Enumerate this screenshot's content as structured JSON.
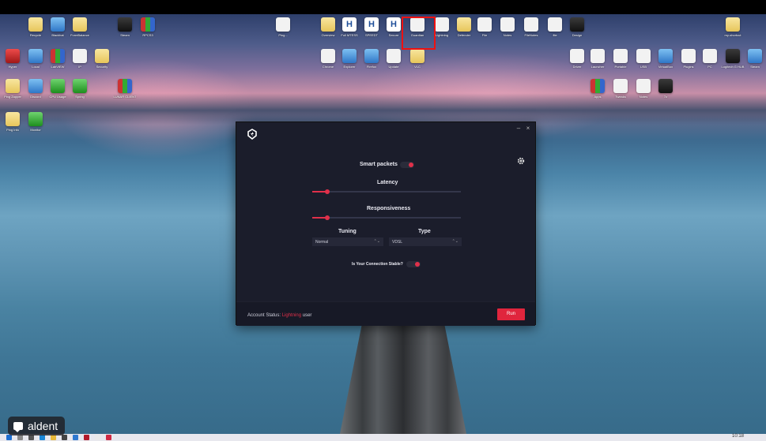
{
  "desktop": {
    "icons": [
      {
        "label": "Recycle",
        "style": "yellow"
      },
      {
        "label": "Blackhat",
        "style": "blue"
      },
      {
        "label": "FormBalance",
        "style": "yellow"
      },
      {
        "label": "Steam",
        "style": "dark"
      },
      {
        "label": "RPCS3",
        "style": "multi"
      },
      {
        "label": "Ping...",
        "style": "white"
      },
      {
        "label": "Overview",
        "style": "yellow"
      },
      {
        "label": "Full MTESS",
        "style": "h"
      },
      {
        "label": "SPEEDT",
        "style": "h"
      },
      {
        "label": "Secure",
        "style": "h"
      },
      {
        "label": "Guardian",
        "style": "white"
      },
      {
        "label": "Lightning",
        "style": "white"
      },
      {
        "label": "Defender",
        "style": "yellow"
      },
      {
        "label": "File",
        "style": "white"
      },
      {
        "label": "Notes",
        "style": "white"
      },
      {
        "label": "FileNotes",
        "style": "white"
      },
      {
        "label": "file",
        "style": "white"
      },
      {
        "label": "Design",
        "style": "dark"
      },
      {
        "label": "my-shortcut",
        "style": "yellow"
      },
      {
        "label": "Hyper",
        "style": "red"
      },
      {
        "label": "Local",
        "style": "blue"
      },
      {
        "label": "LabVIEW",
        "style": "multi"
      },
      {
        "label": "IP",
        "style": "white"
      },
      {
        "label": "Security",
        "style": "yellow"
      },
      {
        "label": "Chrome",
        "style": "white"
      },
      {
        "label": "Explorer",
        "style": "blue"
      },
      {
        "label": "Firefox",
        "style": "blue"
      },
      {
        "label": "Update",
        "style": "white"
      },
      {
        "label": "VLC",
        "style": "yellow"
      },
      {
        "label": "Driver",
        "style": "white"
      },
      {
        "label": "Launcher",
        "style": "white"
      },
      {
        "label": "Portable",
        "style": "white"
      },
      {
        "label": "USB",
        "style": "white"
      },
      {
        "label": "VirtualBox",
        "style": "blue"
      },
      {
        "label": "Plugins",
        "style": "white"
      },
      {
        "label": "PC",
        "style": "white"
      },
      {
        "label": "Logitech G HUB",
        "style": "dark"
      },
      {
        "label": "Steam",
        "style": "blue"
      },
      {
        "label": "Ping Zapper",
        "style": "yellow"
      },
      {
        "label": "Discord",
        "style": "blue"
      },
      {
        "label": "CPU Usage",
        "style": "green"
      },
      {
        "label": "Spring",
        "style": "green"
      },
      {
        "label": "LUNAR CLIENT",
        "style": "multi"
      },
      {
        "label": "Apps",
        "style": "multi"
      },
      {
        "label": "Tweaks",
        "style": "white"
      },
      {
        "label": "Notes",
        "style": "white"
      },
      {
        "label": "7z",
        "style": "dark"
      },
      {
        "label": "Ping Info",
        "style": "yellow"
      },
      {
        "label": "Monitor",
        "style": "green"
      }
    ]
  },
  "app": {
    "logo_name": "lightning-logo",
    "minimize": "–",
    "close": "×",
    "smart_packets_label": "Smart packets",
    "smart_packets_on": true,
    "latency_label": "Latency",
    "latency_value": 0.1,
    "responsiveness_label": "Responsiveness",
    "responsiveness_value": 0.1,
    "tuning_label": "Tuning",
    "tuning_value": "Normal",
    "type_label": "Type",
    "type_value": "VDSL",
    "stability_label": "Is Your Connection Stable?",
    "stability_on": true,
    "account_status_label": "Account Status:",
    "account_tier": "Lightning",
    "account_suffix": "user",
    "run_label": "Run",
    "accent_color": "#e0304a"
  },
  "overlay": {
    "name": "aldent"
  },
  "taskbar": {
    "icons": [
      "windows-icon",
      "search-icon",
      "task-view-icon",
      "edge-icon",
      "explorer-icon",
      "store-icon",
      "mail-icon",
      "app-icon",
      "chrome-icon",
      "lightning-icon"
    ],
    "clock": "10:18"
  }
}
